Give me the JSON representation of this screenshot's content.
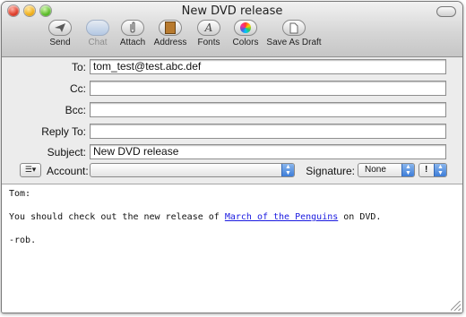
{
  "window": {
    "title": "New DVD release"
  },
  "toolbar": {
    "items": [
      {
        "label": "Send",
        "icon": "paper-plane-icon"
      },
      {
        "label": "Chat",
        "icon": "chat-bubble-icon",
        "disabled": true
      },
      {
        "label": "Attach",
        "icon": "paperclip-icon"
      },
      {
        "label": "Address",
        "icon": "address-book-icon"
      },
      {
        "label": "Fonts",
        "icon": "font-letter-icon"
      },
      {
        "label": "Colors",
        "icon": "color-wheel-icon"
      },
      {
        "label": "Save As Draft",
        "icon": "draft-document-icon"
      }
    ]
  },
  "fields": {
    "to": {
      "label": "To:",
      "value": "tom_test@test.abc.def"
    },
    "cc": {
      "label": "Cc:",
      "value": ""
    },
    "bcc": {
      "label": "Bcc:",
      "value": ""
    },
    "reply_to": {
      "label": "Reply To:",
      "value": ""
    },
    "subject": {
      "label": "Subject:",
      "value": "New DVD release"
    }
  },
  "account": {
    "label": "Account:",
    "value": ""
  },
  "signature": {
    "label": "Signature:",
    "value": "None"
  },
  "priority": {
    "value": "!"
  },
  "body": {
    "greeting": "Tom:",
    "line_prefix": "You should check out the new release of ",
    "link_text": "March of the Penguins",
    "line_suffix": " on DVD.",
    "closing": "-rob."
  },
  "colors": {
    "link": "#1a1ae0",
    "popup_accent": "#3d7dd8"
  }
}
